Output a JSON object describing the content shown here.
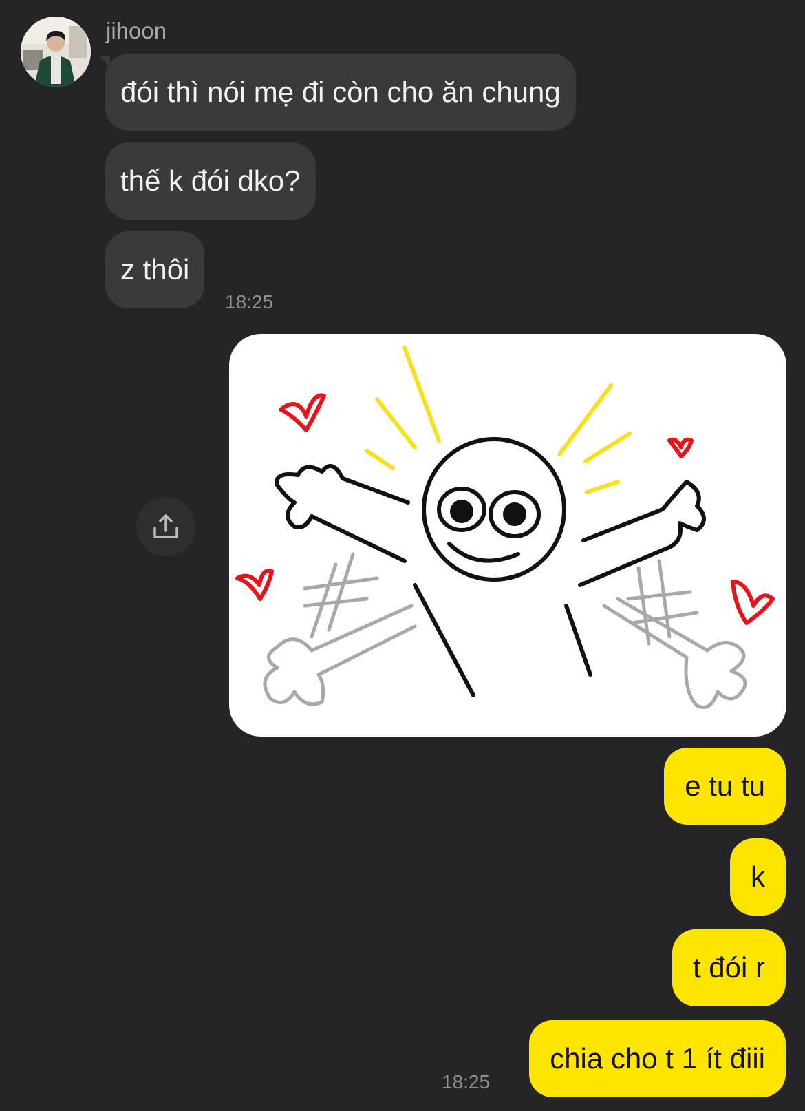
{
  "incoming": {
    "sender_name": "jihoon",
    "messages": [
      {
        "text": "đói thì nói mẹ đi còn cho ăn chung"
      },
      {
        "text": "thế k đói dko?"
      },
      {
        "text": "z thôi"
      }
    ],
    "timestamp": "18:25"
  },
  "outgoing": {
    "sticker": {
      "icon": "stick-figure-hug-sticker"
    },
    "messages": [
      {
        "text": "e tu tu"
      },
      {
        "text": "k"
      },
      {
        "text": "t đói r"
      },
      {
        "text": "chia cho t 1 ít điii"
      }
    ],
    "timestamp": "18:25"
  },
  "share_button": {
    "icon": "share-icon"
  },
  "colors": {
    "background": "#252527",
    "incoming_bubble": "#3a3a3d",
    "outgoing_bubble": "#fee500",
    "heart": "#e8141c",
    "rays": "#f6e11a"
  }
}
